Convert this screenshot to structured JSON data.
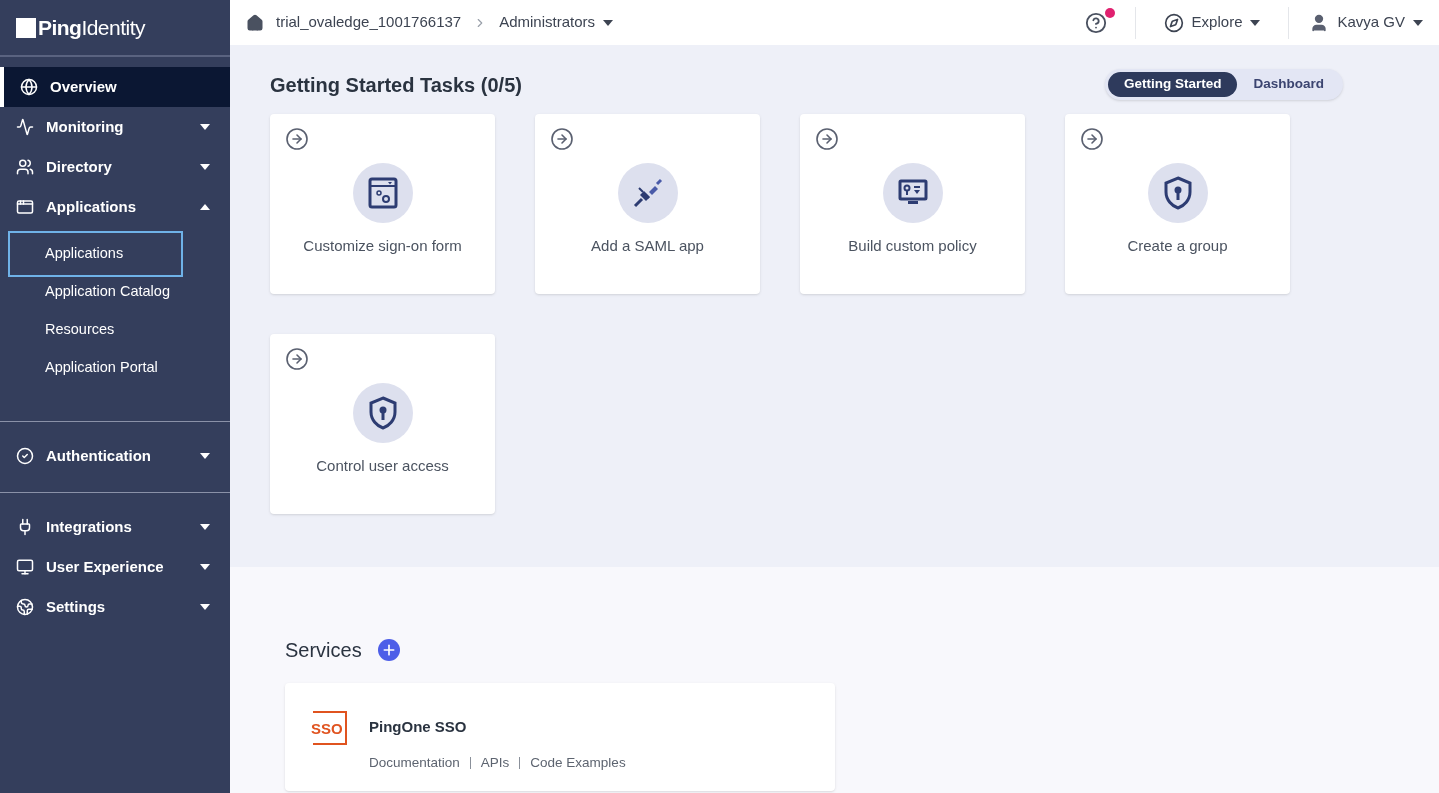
{
  "logo": {
    "text": "**Ping**Identity"
  },
  "sidebar": {
    "groups": [
      [
        {
          "label": "Overview",
          "kind": "globe",
          "selected": true
        },
        {
          "label": "Monitoring",
          "kind": "pulse",
          "selected": false,
          "expanded": false
        },
        {
          "label": "Directory",
          "kind": "users",
          "selected": false,
          "expanded": false
        },
        {
          "label": "Applications",
          "kind": "window",
          "selected": false,
          "expanded": true,
          "children": [
            {
              "label": "Applications",
              "selected": true
            },
            {
              "label": "Application Catalog",
              "selected": false
            },
            {
              "label": "Resources",
              "selected": false
            },
            {
              "label": "Application Portal",
              "selected": false
            }
          ]
        }
      ],
      [
        {
          "label": "Authentication",
          "kind": "check",
          "selected": false,
          "expanded": false
        }
      ],
      [
        {
          "label": "Integrations",
          "kind": "plug",
          "selected": false,
          "expanded": false
        },
        {
          "label": "User Experience",
          "kind": "monitor",
          "selected": false,
          "expanded": false
        },
        {
          "label": "Settings",
          "kind": "earth",
          "selected": false,
          "expanded": false
        }
      ]
    ]
  },
  "header": {
    "breadcrumb": [
      "trial_ovaledge_1001766137",
      "Administrators"
    ],
    "help": {
      "notification": true
    },
    "explore": "Explore",
    "user": "Kavya GV"
  },
  "title": "Getting Started Tasks (0/5)",
  "view_toggle": [
    {
      "label": "Getting Started",
      "selected": true
    },
    {
      "label": "Dashboard",
      "selected": false
    }
  ],
  "tasks": [
    {
      "label": "Customize sign-on form",
      "kind": "form"
    },
    {
      "label": "Add a SAML app",
      "kind": "plug"
    },
    {
      "label": "Build custom policy",
      "kind": "policy"
    },
    {
      "label": "Create a group",
      "kind": "shield"
    },
    {
      "label": "Control user access",
      "kind": "shield"
    }
  ],
  "services": {
    "title": "Services",
    "items": [
      {
        "logo": "SSO",
        "name": "PingOne SSO",
        "links": [
          "Documentation",
          "APIs",
          "Code Examples"
        ]
      }
    ]
  }
}
